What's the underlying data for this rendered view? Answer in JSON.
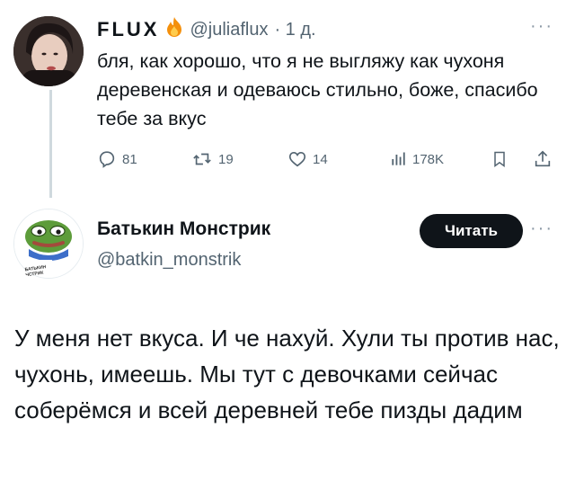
{
  "tweet1": {
    "author_name": "FLUX",
    "handle": "@juliaflux",
    "time": "· 1 д.",
    "more": "···",
    "text": "бля, как хорошо, что я не выгляжу как чухоня деревенская и одеваюсь стильно, боже, спасибо тебе за вкус",
    "actions": {
      "replies": "81",
      "retweets": "19",
      "likes": "14",
      "views": "178K"
    },
    "badge_icon": "fire-icon"
  },
  "tweet2": {
    "author_name": "Батькин Монстрик",
    "handle": "@batkin_monstrik",
    "more": "···",
    "follow_label": "Читать",
    "text": "У меня нет вкуса. И че нахуй. Хули ты против нас, чухонь, имеешь. Мы тут с девочками сейчас соберёмся и всей деревней тебе пизды дадим",
    "avatar_caption": "БАТЬКИН ЧСТРИК"
  },
  "colors": {
    "text": "#0f1419",
    "secondary": "#536471",
    "button": "#0f1419",
    "fire": "#f4900c"
  }
}
